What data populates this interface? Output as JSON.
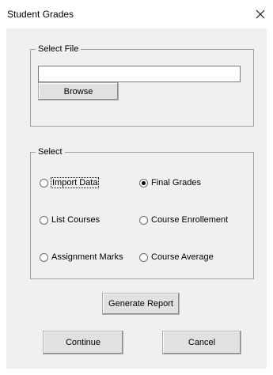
{
  "window": {
    "title": "Student Grades",
    "close_glyph": "×"
  },
  "select_file": {
    "legend": "Select File",
    "path_value": "",
    "browse_label": "Browse"
  },
  "select": {
    "legend": "Select",
    "options": [
      {
        "label": "Import Data",
        "checked": false
      },
      {
        "label": "Final Grades",
        "checked": true
      },
      {
        "label": "List Courses",
        "checked": false
      },
      {
        "label": "Course Enrollement",
        "checked": false
      },
      {
        "label": "Assignment Marks",
        "checked": false
      },
      {
        "label": "Course Average",
        "checked": false
      }
    ]
  },
  "buttons": {
    "generate_report": "Generate Report",
    "continue": "Continue",
    "cancel": "Cancel"
  }
}
